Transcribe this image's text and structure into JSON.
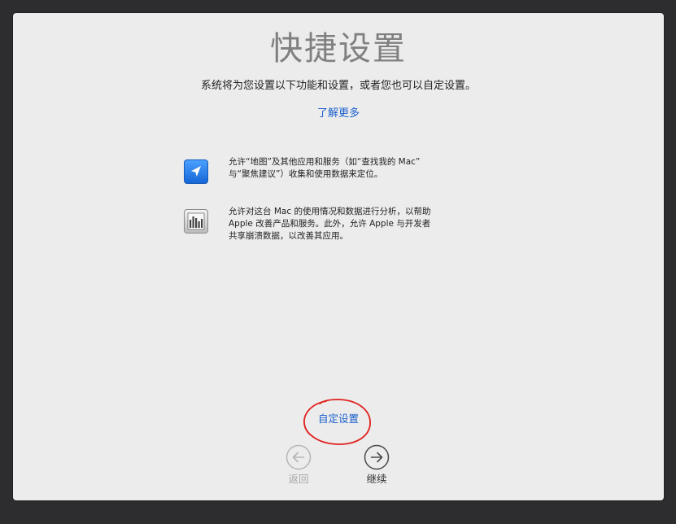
{
  "setup": {
    "title": "快捷设置",
    "subtitle": "系统将为您设置以下功能和设置，或者您也可以自定设置。",
    "learn_more": "了解更多",
    "items": [
      {
        "icon": "location-arrow-icon",
        "lines": [
          "允许“地图”及其他应用和服务（如“查找我的 Mac”",
          "与“聚焦建议”）收集和使用数据来定位。"
        ]
      },
      {
        "icon": "analytics-chart-icon",
        "lines": [
          "允许对这台 Mac 的使用情况和数据进行分析，以帮助",
          "Apple 改善产品和服务。此外，允许 Apple 与开发者",
          "共享崩溃数据，以改善其应用。"
        ]
      }
    ],
    "customize": "自定设置",
    "back_label": "返回",
    "continue_label": "继续"
  },
  "colors": {
    "accent_link": "#1a5fcc",
    "annotation_circle": "#e0201e",
    "back_disabled": "#a8a8a8"
  }
}
